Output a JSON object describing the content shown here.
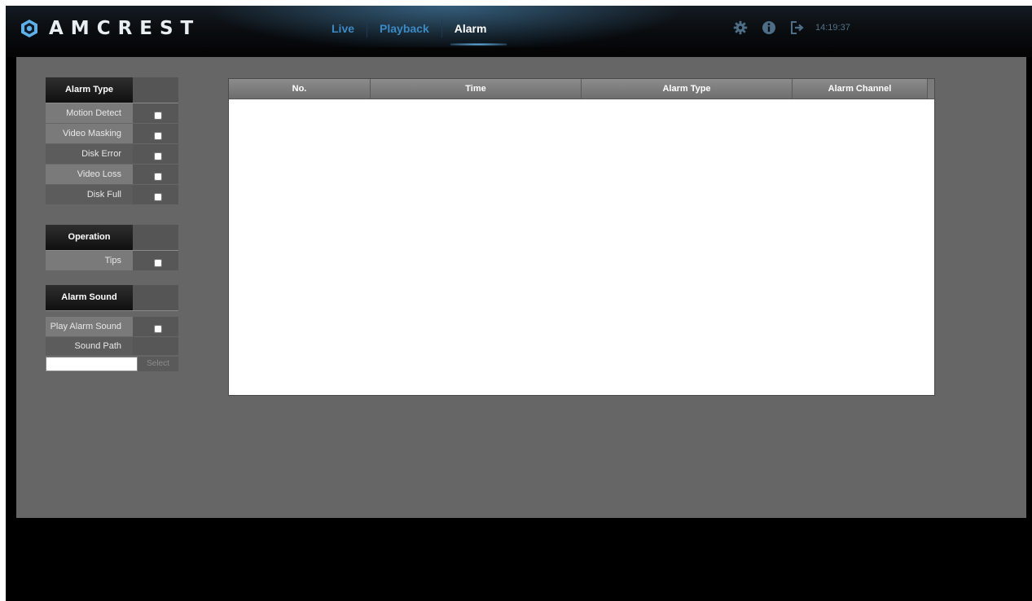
{
  "app": {
    "brand": "AMCREST",
    "clock": "14:19:37"
  },
  "nav": {
    "items": [
      {
        "label": "Live"
      },
      {
        "label": "Playback"
      },
      {
        "label": "Alarm"
      }
    ],
    "active": "Alarm"
  },
  "tools": {
    "icons": [
      "gear-icon",
      "info-icon",
      "logout-icon"
    ]
  },
  "alarm_type": {
    "title": "Alarm Type",
    "items": [
      {
        "label": "Motion Detect",
        "checked": false
      },
      {
        "label": "Video Masking",
        "checked": false
      },
      {
        "label": "Disk Error",
        "checked": false
      },
      {
        "label": "Video Loss",
        "checked": false
      },
      {
        "label": "Disk Full",
        "checked": false
      }
    ]
  },
  "operation": {
    "title": "Operation",
    "items": [
      {
        "label": "Tips",
        "checked": false
      }
    ]
  },
  "alarm_sound": {
    "title": "Alarm Sound",
    "play_label": "Play Alarm Sound",
    "play_checked": false,
    "sound_path_label": "Sound Path",
    "sound_path_value": "",
    "select_label": "Select"
  },
  "table": {
    "columns": [
      "No.",
      "Time",
      "Alarm Type",
      "Alarm Channel"
    ],
    "rows": []
  },
  "colors": {
    "accent": "#3c8ac4",
    "panel": "#666666"
  }
}
